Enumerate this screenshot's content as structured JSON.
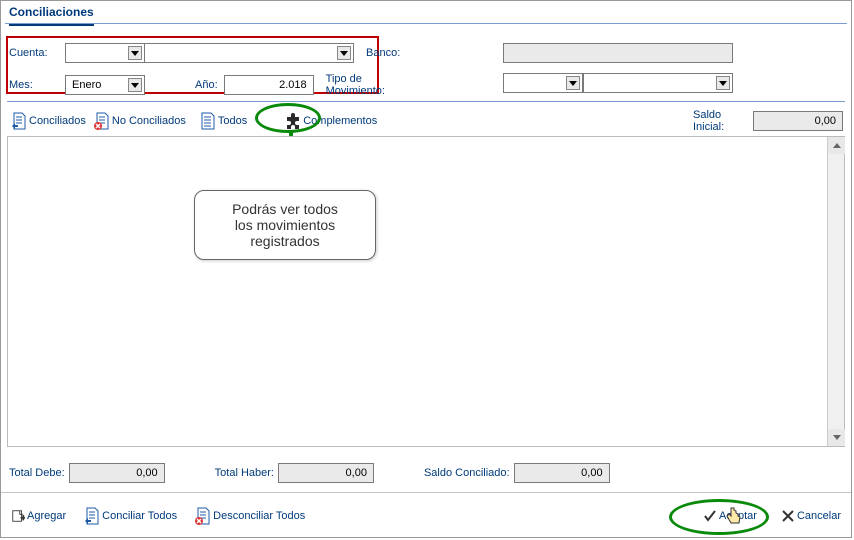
{
  "header": {
    "title": "Conciliaciones"
  },
  "filters": {
    "cuenta_label": "Cuenta:",
    "cuenta1_value": "",
    "cuenta2_value": "",
    "banco_label": "Banco:",
    "banco_value": "",
    "mes_label": "Mes:",
    "mes_value": "Enero",
    "ano_label": "Año:",
    "ano_value": "2.018",
    "tipo_label": "Tipo de Movimiento:",
    "tipo1_value": "",
    "tipo2_value": ""
  },
  "toolbar": {
    "conciliados": "Conciliados",
    "no_conciliados": "No Conciliados",
    "todos": "Todos",
    "complementos": "Complementos",
    "saldo_inicial_label": "Saldo Inicial:",
    "saldo_inicial_value": "0,00"
  },
  "callout": {
    "line1": "Podrás ver todos",
    "line2": "los movimientos",
    "line3": "registrados"
  },
  "totals": {
    "debe_label": "Total Debe:",
    "debe_value": "0,00",
    "haber_label": "Total Haber:",
    "haber_value": "0,00",
    "saldo_conc_label": "Saldo Conciliado:",
    "saldo_conc_value": "0,00"
  },
  "footer": {
    "agregar": "Agregar",
    "conciliar_todos": "Conciliar Todos",
    "desconciliar_todos": "Desconciliar Todos",
    "aceptar": "Aceptar",
    "cancelar": "Cancelar"
  }
}
